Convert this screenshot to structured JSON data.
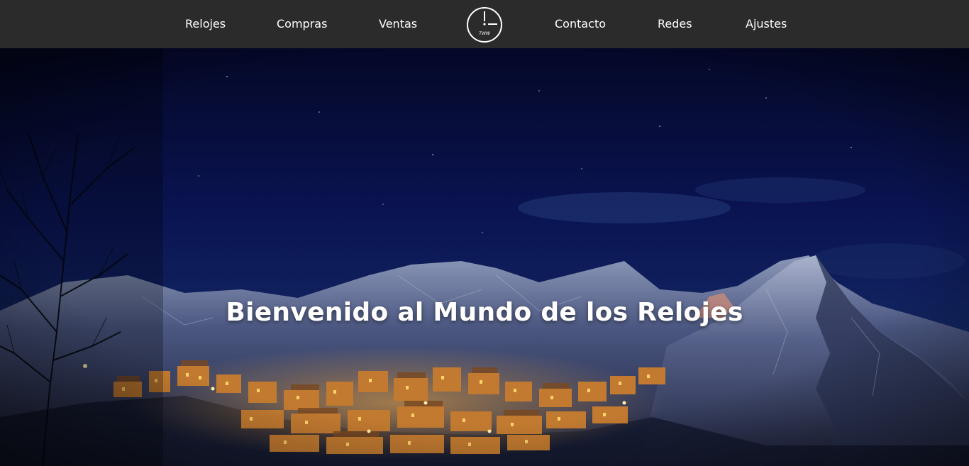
{
  "nav": {
    "items": [
      {
        "label": "Relojes"
      },
      {
        "label": "Compras"
      },
      {
        "label": "Ventas"
      },
      {
        "label": "Contacto"
      },
      {
        "label": "Redes"
      },
      {
        "label": "Ajustes"
      }
    ],
    "logo": {
      "text": "TWW",
      "icon": "clock-icon"
    }
  },
  "hero": {
    "title": "Bienvenido al Mundo de los Relojes"
  },
  "colors": {
    "navbar_bg": "#2b2b2b",
    "nav_text": "#ffffff",
    "sky": "#0a1450",
    "town_lights": "#f0a030"
  }
}
